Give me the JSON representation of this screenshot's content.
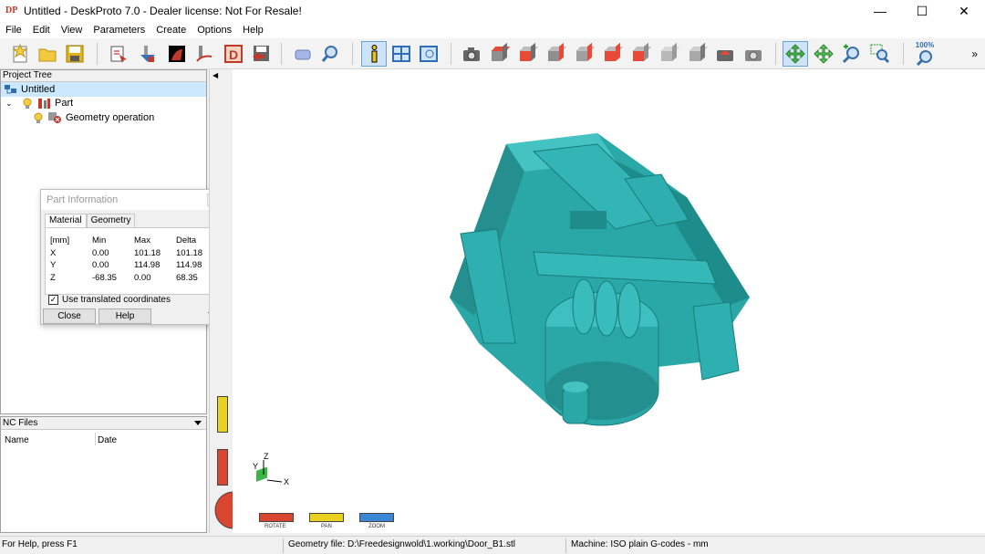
{
  "window": {
    "title": "Untitled - DeskProto 7.0 - Dealer license: Not For Resale!",
    "logo_text": "DP",
    "controls": {
      "minimize": "—",
      "maximize": "☐",
      "close": "✕"
    }
  },
  "menu": [
    "File",
    "Edit",
    "View",
    "Parameters",
    "Create",
    "Options",
    "Help"
  ],
  "toolbar": {
    "zoom_label": "100%",
    "overflow": "»",
    "cube_colors": {
      "face": "#8f8f8f",
      "top": "#bdbdbd",
      "side": "#6f6f6f",
      "highlight": "#e84a3a"
    }
  },
  "project_tree": {
    "header": "Project Tree",
    "items": [
      {
        "label": "Untitled",
        "icon": "project-icon",
        "selected": true
      },
      {
        "label": "Part",
        "icon": "part-icon",
        "expanded": true
      },
      {
        "label": "Geometry operation",
        "icon": "geometry-operation-icon"
      }
    ]
  },
  "part_info": {
    "title": "Part Information",
    "tabs": [
      "Material",
      "Geometry"
    ],
    "active_tab": "Material",
    "columns": [
      "[mm]",
      "Min",
      "Max",
      "Delta"
    ],
    "rows": [
      [
        "X",
        "0.00",
        "101.18",
        "101.18"
      ],
      [
        "Y",
        "0.00",
        "114.98",
        "114.98"
      ],
      [
        "Z",
        "-68.35",
        "0.00",
        "68.35"
      ]
    ],
    "checkbox_label": "Use translated coordinates",
    "checkbox_checked": true,
    "close_label": "Close",
    "help_label": "Help"
  },
  "nc_files": {
    "header": "NC Files",
    "columns": [
      "Name",
      "Date"
    ]
  },
  "viewport": {
    "model_color": "#2aa7a7",
    "axis_labels": {
      "x": "X",
      "y": "Y",
      "z": "Z"
    },
    "nav_controls": [
      {
        "label": "ROTATE",
        "color": "#d9452e"
      },
      {
        "label": "PAN",
        "color": "#e8d21f"
      },
      {
        "label": "ZOOM",
        "color": "#3a87d6"
      }
    ]
  },
  "statusbar": {
    "help": "For Help, press F1",
    "geometry_file": "Geometry file: D:\\Freedesignwold\\1.working\\Door_B1.stl",
    "machine": "Machine: ISO plain G-codes - mm"
  }
}
